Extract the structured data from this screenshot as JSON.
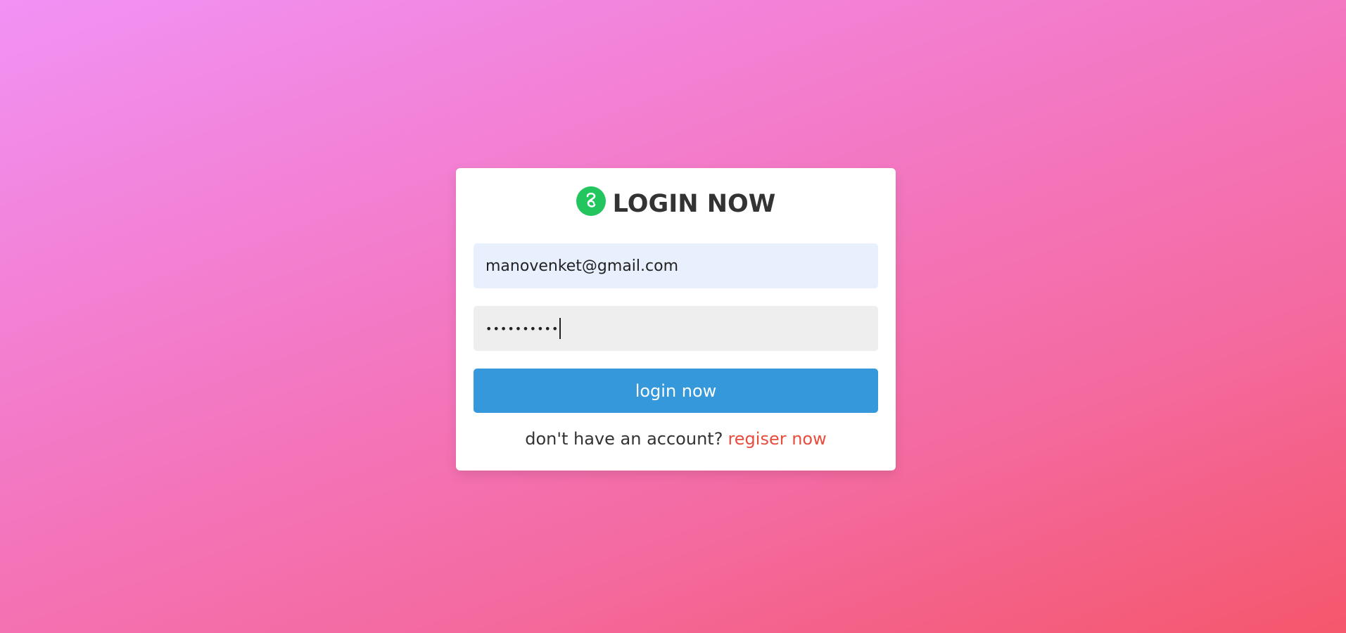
{
  "colors": {
    "background_start": "#f292f5",
    "background_end": "#f5576c",
    "card": "#ffffff",
    "title": "#333333",
    "email_field_bg": "#e8f0fe",
    "password_field_bg": "#eeeeee",
    "primary_button": "#3498db",
    "link": "#e74c3c",
    "logo": "#22c55e"
  },
  "header": {
    "logo_icon": "logo-icon",
    "title": "LOGIN NOW"
  },
  "form": {
    "email": {
      "value": "manovenket@gmail.com"
    },
    "password": {
      "masked_value": "••••••••••"
    },
    "submit_label": "login now"
  },
  "footer": {
    "prompt": "don't have an account?",
    "link_label": "regiser now"
  }
}
